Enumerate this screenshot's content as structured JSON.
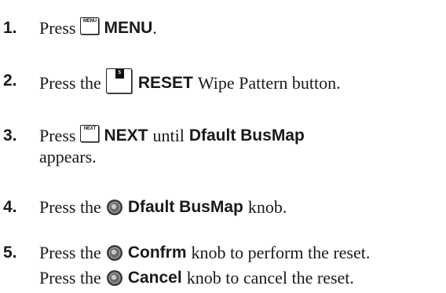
{
  "steps": [
    {
      "number": "1.",
      "text_before": "Press",
      "icon": "menu-key-icon",
      "icon_label": "MENU",
      "bold": "MENU",
      "text_after": "."
    },
    {
      "number": "2.",
      "text_before": "Press the",
      "icon": "reset-button-icon",
      "icon_label": "5",
      "bold": "RESET",
      "text_after": "Wipe Pattern button."
    },
    {
      "number": "3.",
      "text_before": "Press",
      "icon": "next-key-icon",
      "icon_label": "NEXT",
      "bold": "NEXT",
      "text_middle": "until",
      "bold2": "Dfault BusMap",
      "continuation": "appears."
    },
    {
      "number": "4.",
      "text_before": "Press the",
      "icon": "knob-icon",
      "bold": "Dfault BusMap",
      "text_after": "knob."
    },
    {
      "number": "5.",
      "text_before": "Press the",
      "icon": "knob-icon",
      "bold": "Confrm",
      "text_after": "knob to perform the reset.",
      "line2": {
        "text_before": "Press the",
        "icon": "knob-icon",
        "bold": "Cancel",
        "text_after": "knob to cancel the reset."
      }
    }
  ]
}
